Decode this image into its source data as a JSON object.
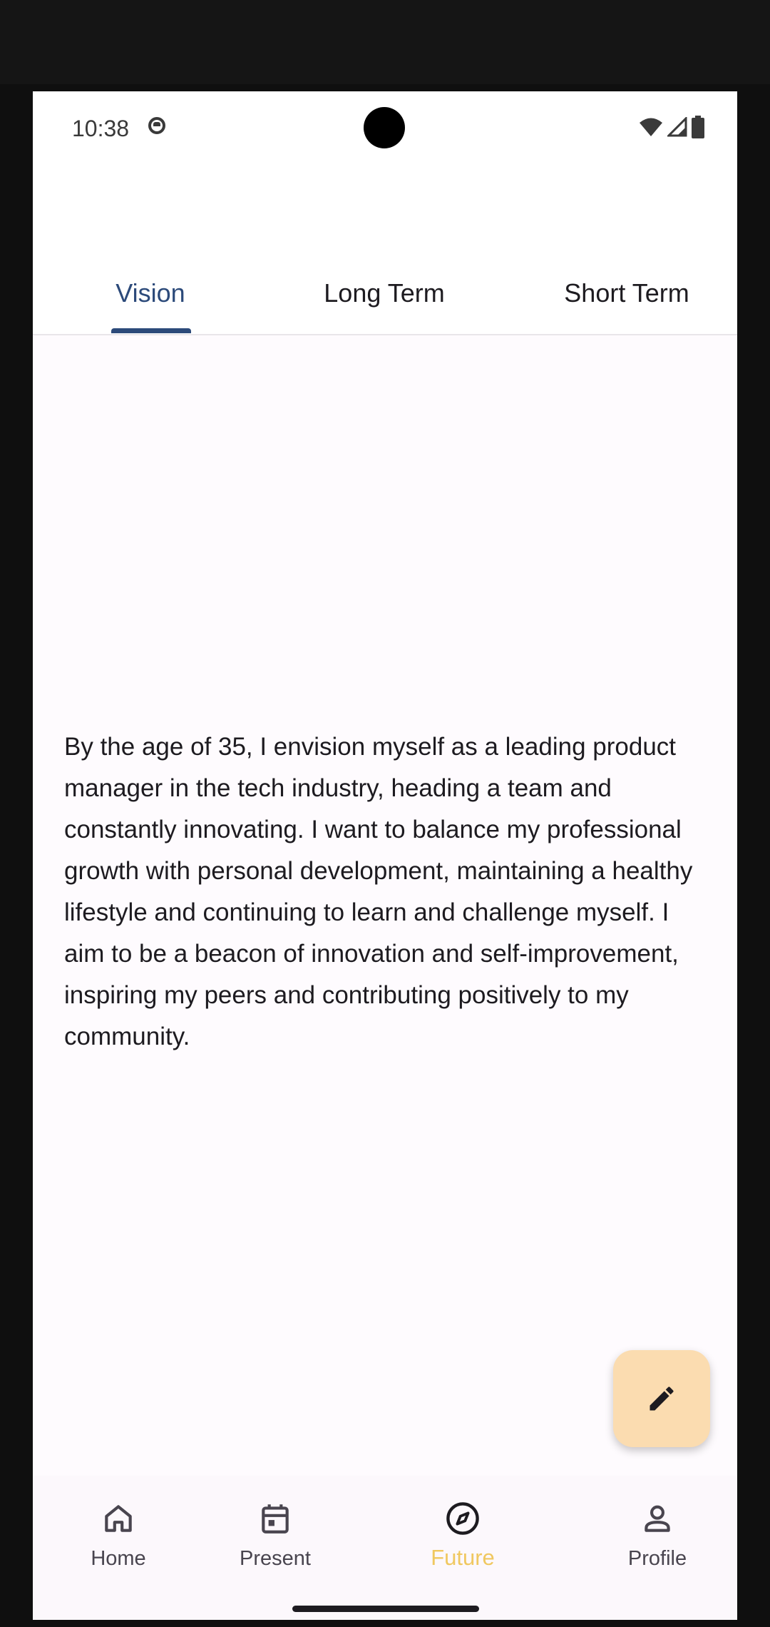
{
  "status_bar": {
    "time": "10:38"
  },
  "tabs": [
    {
      "label": "Vision",
      "active": true
    },
    {
      "label": "Long Term",
      "active": false
    },
    {
      "label": "Short Term",
      "active": false
    }
  ],
  "vision": {
    "text": "By the age of 35, I envision myself as a leading product manager in the tech industry, heading a team and constantly innovating. I want to balance my professional growth with personal development, maintaining a healthy lifestyle and continuing to learn and challenge myself. I aim to be a beacon of innovation and self-improvement, inspiring my peers and contributing positively to my community."
  },
  "fab": {
    "icon": "pencil-icon",
    "color": "#fbdcb0"
  },
  "bottom_nav": [
    {
      "label": "Home",
      "icon": "home-icon",
      "active": false
    },
    {
      "label": "Present",
      "icon": "calendar-icon",
      "active": false
    },
    {
      "label": "Future",
      "icon": "compass-icon",
      "active": true
    },
    {
      "label": "Profile",
      "icon": "person-icon",
      "active": false
    }
  ],
  "colors": {
    "accent": "#2c4a7a",
    "active_nav": "#f0c860"
  }
}
